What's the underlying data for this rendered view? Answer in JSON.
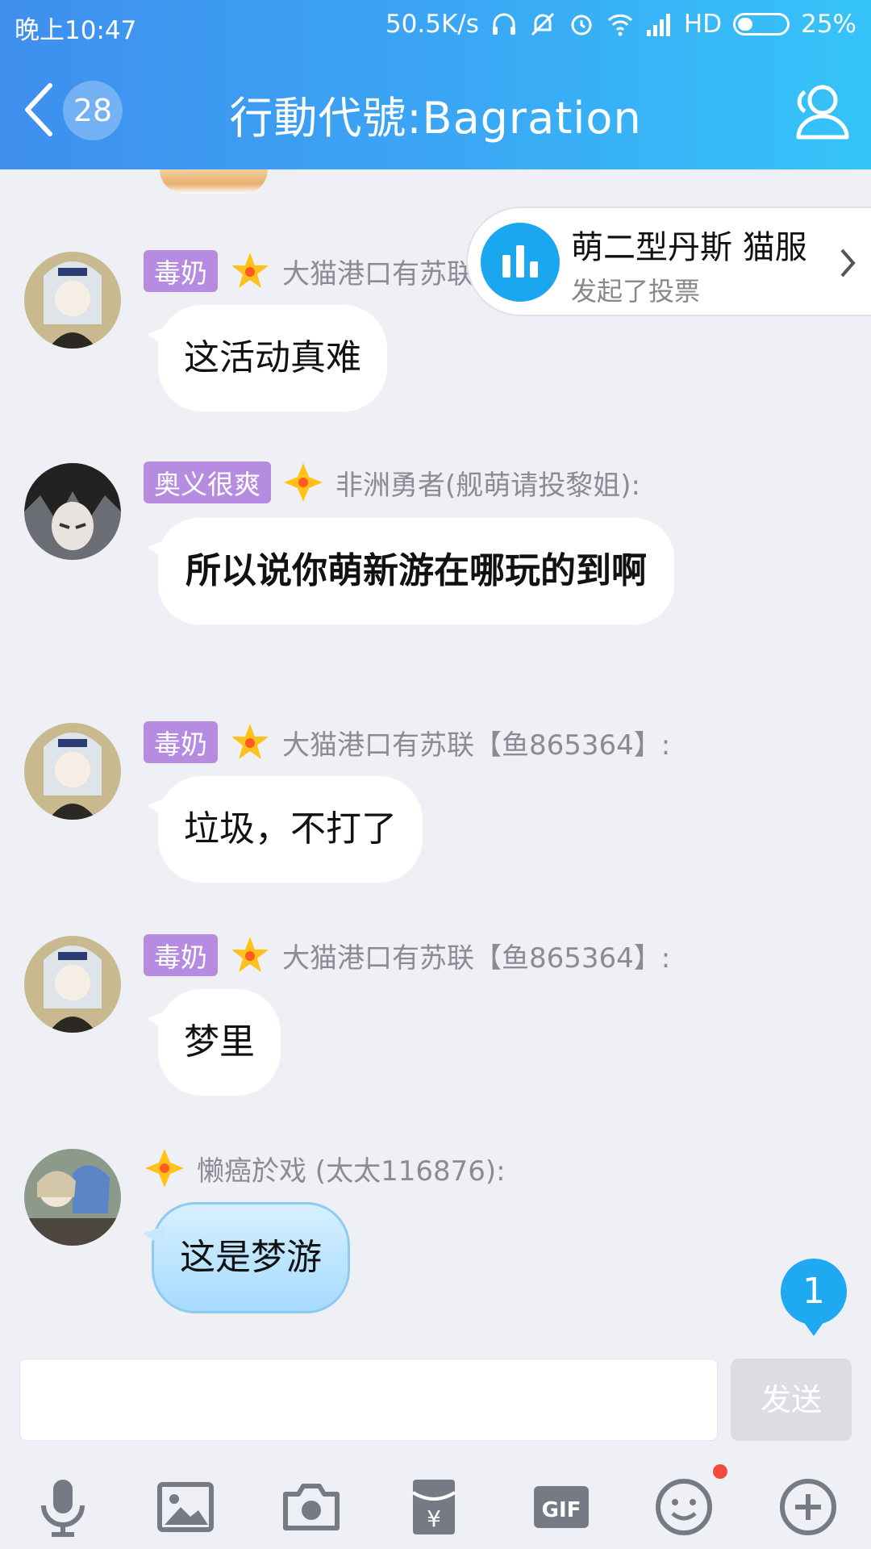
{
  "status_bar": {
    "time": "晚上10:47",
    "speed": "50.5K/s",
    "network": "HD",
    "battery": "25%"
  },
  "header": {
    "back_count": "28",
    "title": "行動代號:Bagration"
  },
  "vote_banner": {
    "title": "萌二型丹斯 猫服",
    "subtitle": "发起了投票"
  },
  "messages": [
    {
      "tag": "毒奶",
      "sender": "大猫港口有苏联",
      "text": "这活动真难"
    },
    {
      "tag": "奥义很爽",
      "sender": "非洲勇者(舰萌请投黎姐):",
      "text": "所以说你萌新游在哪玩的到啊"
    },
    {
      "tag": "毒奶",
      "sender": "大猫港口有苏联【鱼865364】:",
      "text": "垃圾，不打了"
    },
    {
      "tag": "毒奶",
      "sender": "大猫港口有苏联【鱼865364】:",
      "text": "梦里"
    },
    {
      "tag": "",
      "sender": "懒癌於戏 (太太116876):",
      "text": "这是梦游"
    }
  ],
  "new_message_count": "1",
  "composer": {
    "send_label": "发送"
  },
  "toolbar_icons": [
    "mic-icon",
    "image-icon",
    "camera-icon",
    "red-packet-icon",
    "gif-icon",
    "emoji-icon",
    "plus-icon"
  ],
  "colors": {
    "header_start": "#3f8fee",
    "header_end": "#35c4f9",
    "tag_purple": "#b58cdf",
    "accent_blue": "#1fa9f1",
    "background": "#eff0f5"
  }
}
